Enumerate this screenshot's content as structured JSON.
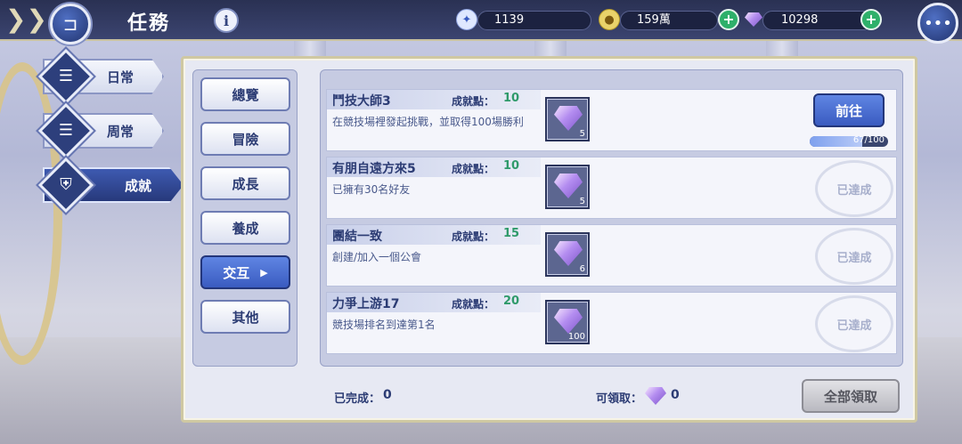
{
  "header": {
    "title": "任務",
    "resources": [
      {
        "icon": "blue-coin-icon",
        "value": "1139"
      },
      {
        "icon": "gold-coin-icon",
        "value": "159萬"
      },
      {
        "icon": "diamond-icon",
        "value": "10298"
      }
    ]
  },
  "categories": [
    {
      "label": "日常"
    },
    {
      "label": "周常"
    },
    {
      "label": "成就"
    }
  ],
  "sub_tabs": [
    {
      "label": "總覽"
    },
    {
      "label": "冒險"
    },
    {
      "label": "成長"
    },
    {
      "label": "養成"
    },
    {
      "label": "交互"
    },
    {
      "label": "其他"
    }
  ],
  "achievements": [
    {
      "name": "鬥技大師3",
      "points_label": "成就點：",
      "points": "10",
      "desc": "在競技場裡發起挑戰，並取得100場勝利",
      "reward_count": "5",
      "action": "前往",
      "progress_text": "67/100",
      "progress": 0.67
    },
    {
      "name": "有朋自遠方來5",
      "points_label": "成就點：",
      "points": "10",
      "desc": "已擁有30名好友",
      "reward_count": "5",
      "status": "已達成"
    },
    {
      "name": "團結一致",
      "points_label": "成就點：",
      "points": "15",
      "desc": "創建/加入一個公會",
      "reward_count": "6",
      "status": "已達成"
    },
    {
      "name": "力爭上游17",
      "points_label": "成就點：",
      "points": "20",
      "desc": "競技場排名到達第1名",
      "reward_count": "100",
      "status": "已達成"
    }
  ],
  "footer": {
    "completed_label": "已完成：",
    "completed_value": "0",
    "claimable_label": "可領取：",
    "claimable_value": "0",
    "claim_all": "全部領取"
  },
  "colors": {
    "accent": "#3a5bc0",
    "points": "#2f9a6a",
    "frame": "#cfc8a2"
  }
}
